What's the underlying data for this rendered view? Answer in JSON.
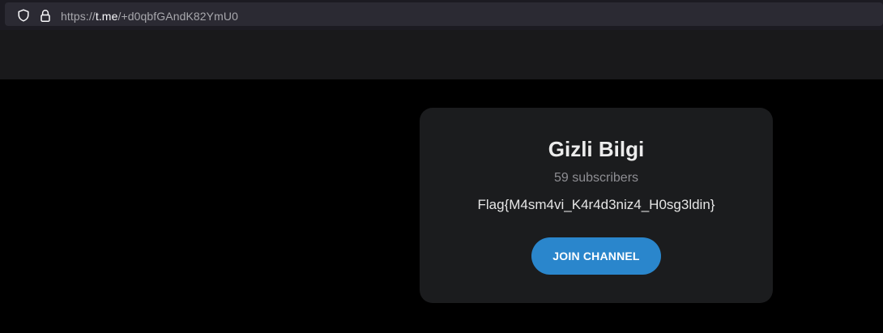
{
  "browser": {
    "url_scheme": "https://",
    "url_host": "t.me",
    "url_path": "/+d0qbfGAndK82YmU0",
    "icons": {
      "shield": "shield-icon",
      "lock": "lock-icon"
    }
  },
  "channel": {
    "title": "Gizli Bilgi",
    "subscribers": "59 subscribers",
    "description": "Flag{M4sm4vi_K4r4d3niz4_H0sg3ldin}",
    "join_label": "JOIN CHANNEL"
  },
  "colors": {
    "accent": "#2a86cc",
    "card_background": "#1b1c1e",
    "page_background": "#000000"
  }
}
